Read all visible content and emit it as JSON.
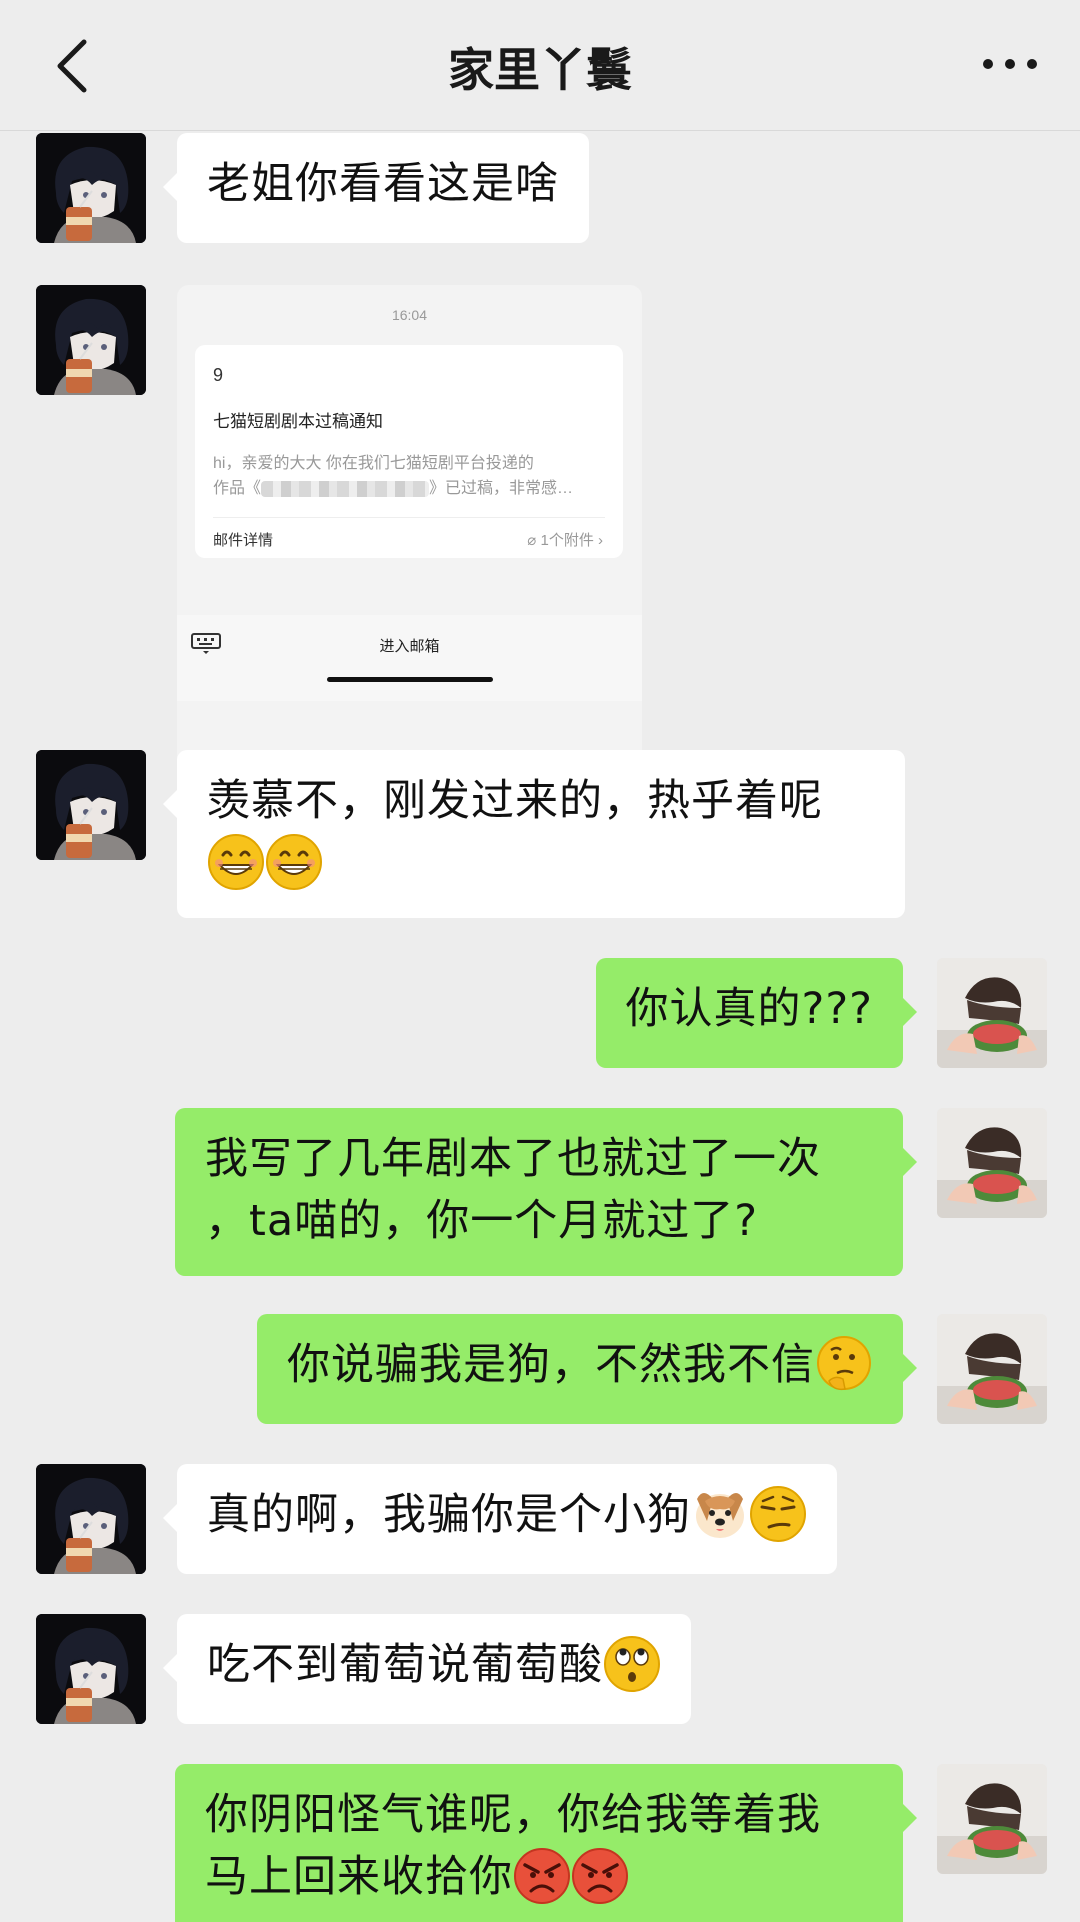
{
  "header": {
    "title": "家里丫鬟"
  },
  "screenshot_card": {
    "time": "16:04",
    "sender": "9",
    "subject": "七猫短剧剧本过稿通知",
    "preview_line1": "hi，亲爱的大大 你在我们七猫短剧平台投递的",
    "preview_line2_before": "作品《",
    "preview_line2_after": "》已过稿，非常感…",
    "details_label": "邮件详情",
    "attachments_label": "1个附件",
    "enter_mailbox_label": "进入邮箱"
  },
  "messages": [
    {
      "side": "left",
      "text": "老姐你看看这是啥"
    },
    {
      "side": "left",
      "type": "image"
    },
    {
      "side": "left",
      "text": "羡慕不，刚发过来的，热乎着呢",
      "emojis": [
        "grin-emoji",
        "grin-emoji"
      ]
    },
    {
      "side": "right",
      "text": "你认真的???"
    },
    {
      "side": "right",
      "text_line1": "我写了几年剧本了也就过了一次",
      "text_line2": "，ta喵的，你一个月就过了?"
    },
    {
      "side": "right",
      "text": "你说骗我是狗，不然我不信",
      "emojis": [
        "thinking-emoji"
      ]
    },
    {
      "side": "left",
      "text": "真的啊，我骗你是个小狗",
      "emojis": [
        "dog-emoji",
        "smirk-emoji"
      ]
    },
    {
      "side": "left",
      "text": "吃不到葡萄说葡萄酸",
      "emojis": [
        "eye-roll-emoji"
      ]
    },
    {
      "side": "right",
      "text_line1": "你阴阳怪气谁呢，你给我等着我",
      "text_line2": "马上回来收拾你",
      "emojis": [
        "angry-emoji",
        "angry-emoji"
      ]
    }
  ],
  "colors": {
    "background": "#ededed",
    "self_bubble": "#95ec69",
    "other_bubble": "#ffffff"
  }
}
